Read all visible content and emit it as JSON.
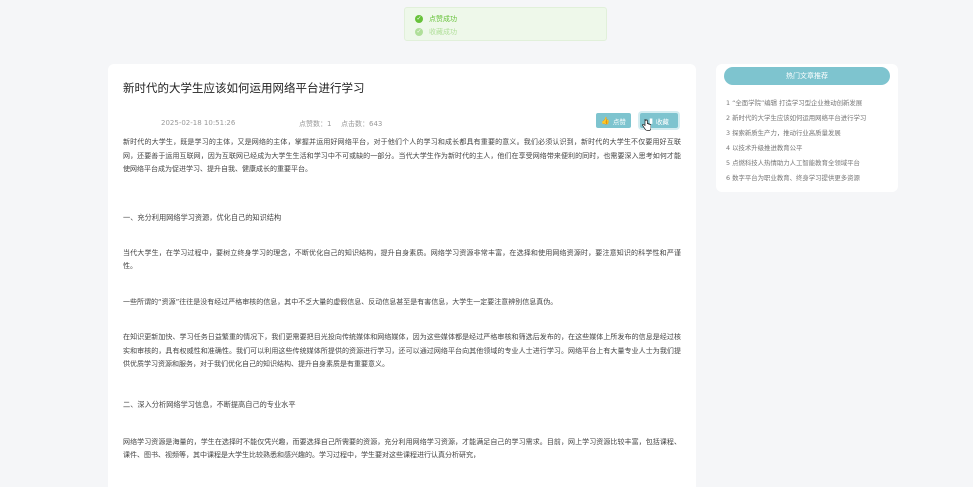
{
  "toast": {
    "messages": [
      "点赞成功",
      "收藏成功"
    ]
  },
  "article": {
    "title": "新时代的大学生应该如何运用网络平台进行学习",
    "date": "2025-02-18 10:51:26",
    "likes": "点赞数：1",
    "clicks": "点击数：643",
    "like_button": "点赞",
    "fav_button": "收藏",
    "paragraphs": [
      "新时代的大学生，既是学习的主体，又是网络的主体，掌握并运用好网络平台，对于他们个人的学习和成长都具有重要的意义。我们必须认识到，新时代的大学生不仅要用好互联网，还要善于运用互联网，因为互联网已经成为大学生生活和学习中不可或缺的一部分。当代大学生作为新时代的主人，他们在享受网络带来便利的同时，也需要深入思考如何才能使网络平台成为促进学习、提升自我、健康成长的重要平台。",
      "一、充分利用网络学习资源，优化自己的知识结构",
      "当代大学生，在学习过程中，要树立终身学习的理念，不断优化自己的知识结构，提升自身素质。网络学习资源非常丰富，在选择和使用网络资源时，要注意知识的科学性和严谨性。",
      "一些所谓的“资源”往往是没有经过严格审核的信息，其中不乏大量的虚假信息、反动信息甚至是有害信息，大学生一定要注意辨别信息真伪。",
      "在知识更新加快、学习任务日益繁重的情况下，我们更需要把目光投向传统媒体和网络媒体，因为这些媒体都是经过严格审核和筛选后发布的，在这些媒体上所发布的信息是经过核实和审核的，具有权威性和准确性。我们可以利用这些传统媒体所提供的资源进行学习，还可以通过网络平台向其他领域的专业人士进行学习。网络平台上有大量专业人士为我们提供优质学习资源和服务，对于我们优化自己的知识结构、提升自身素质是有重要意义。",
      "二、深入分析网络学习信息，不断提高自己的专业水平",
      "网络学习资源是海量的，学生在选择时不能仅凭兴趣，而要选择自己所需要的资源，充分利用网络学习资源，才能满足自己的学习需求。目前，网上学习资源比较丰富，包括课程、课件、图书、视频等，其中课程是大学生比较熟悉和感兴趣的。学习过程中，学生要对这些课程进行认真分析研究，"
    ]
  },
  "sidebar": {
    "title": "热门文章推荐",
    "items": [
      "1  “全面学院”编辑 打造学习型企业推动创新发展",
      "2  新时代的大学生应该如何运用网络平台进行学习",
      "3  探索新质生产力，推动行业高质量发展",
      "4  以技术升级推进教育公平",
      "5  点燃科技人热情助力人工智能教育全领域平台",
      "6  数字平台为职业教育、终身学习提供更多资源"
    ]
  }
}
